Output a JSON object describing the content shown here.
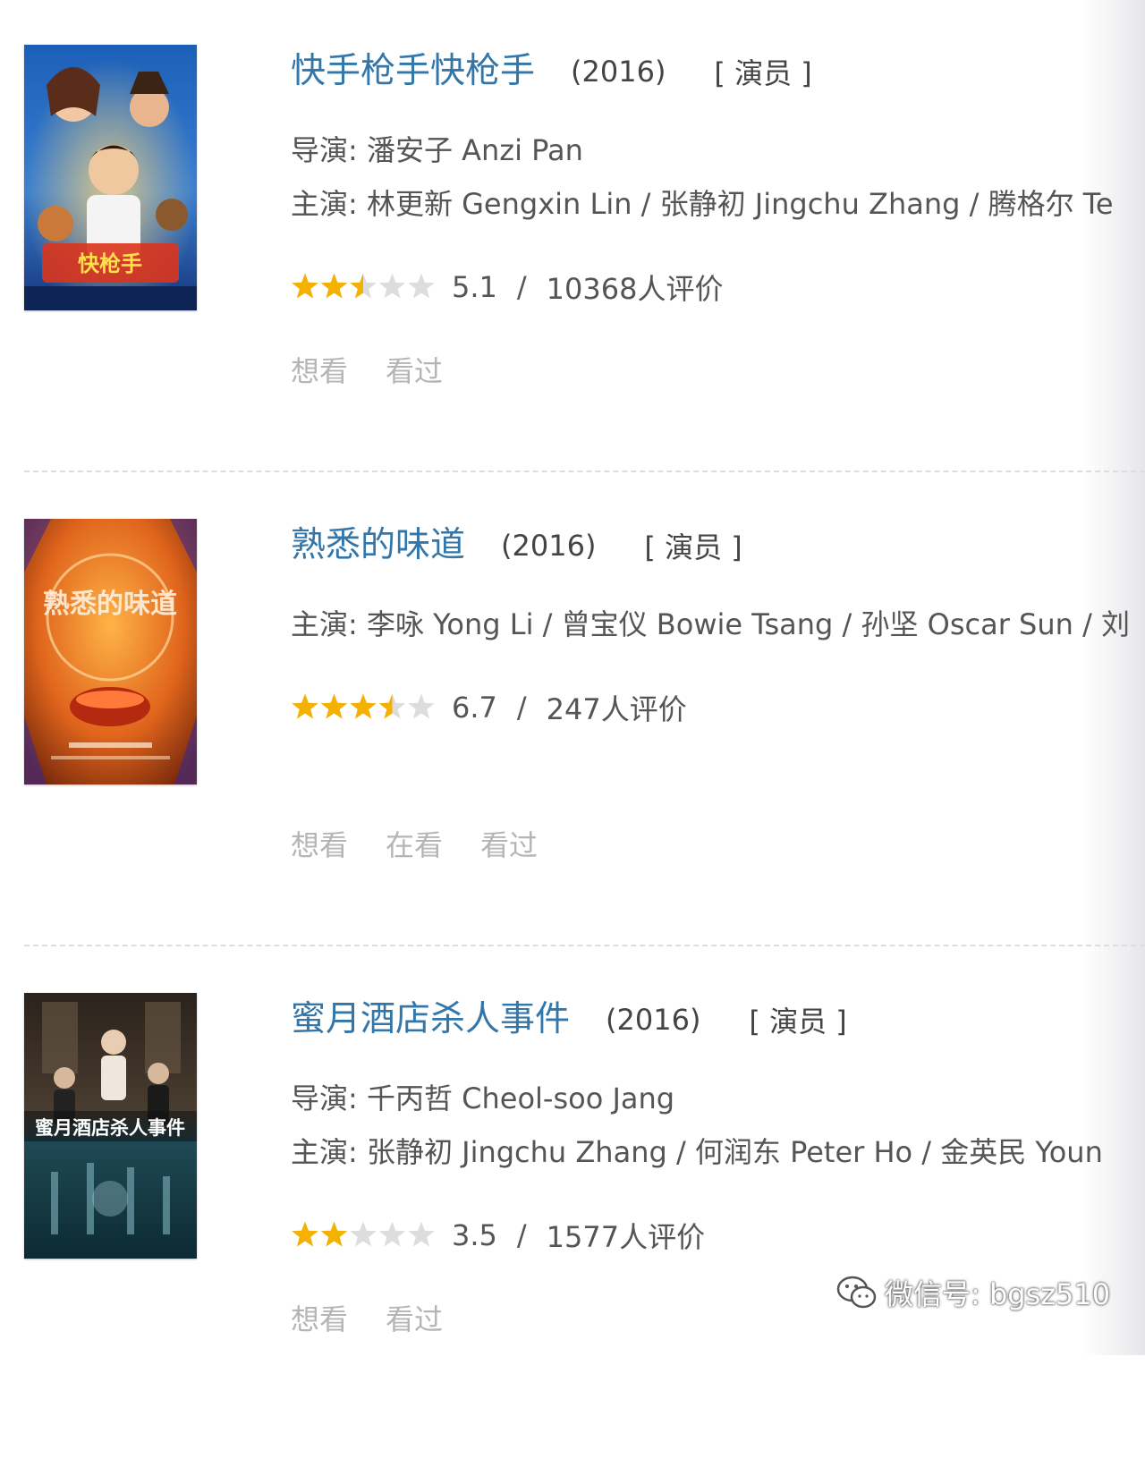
{
  "colors": {
    "title_link": "#3377aa",
    "text": "#555555",
    "muted_action": "#b5b5b5",
    "star_filled": "#f5b100",
    "star_empty": "#dddddd"
  },
  "movies": [
    {
      "title": "快手枪手快枪手",
      "year": "(2016)",
      "role": "[ 演员 ]",
      "director": "导演: 潘安子 Anzi Pan",
      "cast": "主演: 林更新 Gengxin Lin / 张静初 Jingchu Zhang / 腾格尔 Te",
      "rating": 5.1,
      "score": "5.1",
      "separator": "/",
      "votes": "10368人评价",
      "actions": [
        "想看",
        "看过"
      ]
    },
    {
      "title": "熟悉的味道",
      "year": "(2016)",
      "role": "[ 演员 ]",
      "cast": "主演: 李咏 Yong Li / 曾宝仪 Bowie Tsang / 孙坚 Oscar Sun / 刘",
      "rating": 6.7,
      "score": "6.7",
      "separator": "/",
      "votes": "247人评价",
      "actions": [
        "想看",
        "在看",
        "看过"
      ]
    },
    {
      "title": "蜜月酒店杀人事件",
      "year": "(2016)",
      "role": "[ 演员 ]",
      "director": "导演: 千丙哲 Cheol-soo Jang",
      "cast": "主演: 张静初 Jingchu Zhang / 何润东 Peter Ho / 金英民 Youn",
      "rating": 3.5,
      "score": "3.5",
      "separator": "/",
      "votes": "1577人评价",
      "actions": [
        "想看",
        "看过"
      ]
    }
  ],
  "posters": [
    {
      "caption": "快枪手"
    },
    {
      "caption": "熟悉的味道"
    },
    {
      "caption": "蜜月酒店杀人事件"
    }
  ],
  "watermark": {
    "icon": "wechat-icon",
    "text": "微信号: bgsz510"
  }
}
